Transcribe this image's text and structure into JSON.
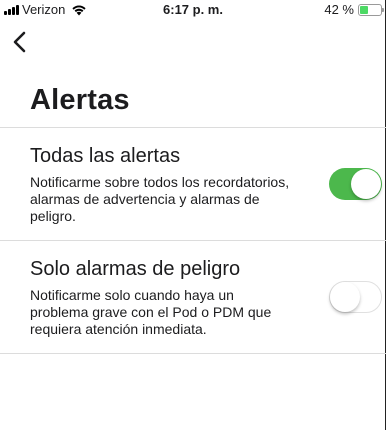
{
  "status_bar": {
    "carrier": "Verizon",
    "time": "6:17 p. m.",
    "battery_percent": "42 %",
    "battery_level": 0.42
  },
  "header": {
    "back_icon": "chevron-left-icon",
    "title": "Alertas"
  },
  "settings": [
    {
      "title": "Todas las alertas",
      "description": "Notificarme sobre todos los recordatorios, alarmas de advertencia y alarmas de peligro.",
      "enabled": true
    },
    {
      "title": "Solo alarmas de peligro",
      "description": "Notificarme solo cuando haya un problema grave con el Pod o PDM que requiera atención inmediata.",
      "enabled": false
    }
  ],
  "colors": {
    "toggle_on": "#4cb84c",
    "battery_fill": "#4cd964"
  }
}
